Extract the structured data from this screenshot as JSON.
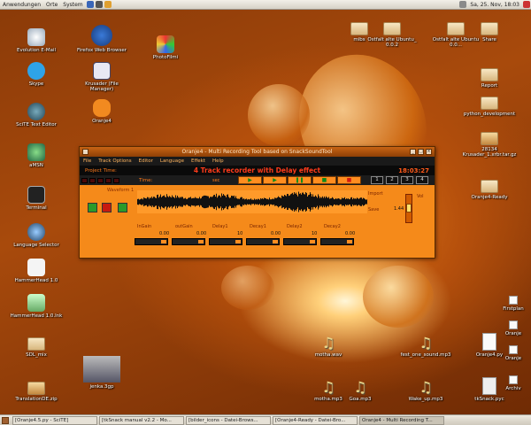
{
  "top_panel": {
    "menus": [
      "Anwendungen",
      "Orte",
      "System"
    ],
    "clock": "Sa, 25. Nov, 18:03"
  },
  "desktop_icons_left": [
    {
      "label": "Evolution E-Mail",
      "icon": "evolution-mail-icon"
    },
    {
      "label": "Skype",
      "icon": "skype-icon"
    },
    {
      "label": "SciTE Text Editor",
      "icon": "scite-editor-icon"
    },
    {
      "label": "aMSN",
      "icon": "amsn-icon"
    },
    {
      "label": "Terminal",
      "icon": "terminal-icon"
    },
    {
      "label": "Language Selector",
      "icon": "language-selector-icon"
    },
    {
      "label": "HammerHead 1.0",
      "icon": "hammer-icon"
    },
    {
      "label": "HammerHead 1.0.lnk",
      "icon": "hammer-link-icon"
    },
    {
      "label": "SDL_mix",
      "icon": "folder-icon"
    },
    {
      "label": "TranslationDE.zip",
      "icon": "archive-icon"
    }
  ],
  "desktop_icons_mid": [
    {
      "label": "Firefox Web Browser",
      "icon": "firefox-icon"
    },
    {
      "label": "Krusader (File Manager)",
      "icon": "krusader-icon"
    },
    {
      "label": "Oranje4",
      "icon": "oranje-icon"
    },
    {
      "label": "PhotoFilmi",
      "icon": "photofilm-icon"
    },
    {
      "label": "jenka.3gp",
      "icon": "video-icon"
    }
  ],
  "desktop_icons_right": [
    {
      "label": "mibs"
    },
    {
      "label": "Ostfalt alte Ubuntu_ 0.0.2"
    },
    {
      "label": "Ostfalt alte Ubuntu 0.0..."
    },
    {
      "label": "Share"
    },
    {
      "label": "Report"
    },
    {
      "label": "python_development"
    },
    {
      "label": "28134 Krusader_1.xrbr.tar.gz"
    },
    {
      "label": "Oranje4-Ready"
    }
  ],
  "desktop_files_bottom": [
    {
      "label": "motha.wav",
      "icon": "music-note-icon"
    },
    {
      "label": "fest_one_sound.mp3",
      "icon": "music-note-icon"
    },
    {
      "label": "Oranje4.py",
      "icon": "python-file-icon"
    },
    {
      "label": "motha.mp3",
      "icon": "music-note-icon"
    },
    {
      "label": "Goa.mp3",
      "icon": "music-note-icon"
    },
    {
      "label": "Wake_up.mp3",
      "icon": "music-note-icon"
    },
    {
      "label": "tkSnack.pyc",
      "icon": "pyc-file-icon"
    }
  ],
  "desktop_files_far_right": [
    "Firstplan",
    "Oranje",
    "Oranje",
    "Archiv"
  ],
  "app": {
    "title": "Oranje4 - Multi Recording Tool based on SnackSoundTool",
    "menus": [
      "File",
      "Track Options",
      "Editor",
      "Language",
      "Effekt",
      "Help"
    ],
    "project_label": "Project Time:",
    "main_title": "4 Track recorder with Delay effect",
    "clock": "18:03:27",
    "time_label": "Time:",
    "sec_label": "sec",
    "transport": [
      "▶",
      "▶",
      "❚❚",
      "■",
      "■"
    ],
    "tracks": [
      "1",
      "2",
      "3",
      "4"
    ],
    "waveform_label": "Waveform 1",
    "import_label": "Import",
    "save_label": "Save",
    "vol_label": "Vol",
    "vol_value": "1.44",
    "params": [
      {
        "label": "InGain",
        "value": "0.00"
      },
      {
        "label": "outGain",
        "value": "0.00"
      },
      {
        "label": "Delay1",
        "value": "10"
      },
      {
        "label": "Decay1",
        "value": "0.00"
      },
      {
        "label": "Delay2",
        "value": "10"
      },
      {
        "label": "Decay2",
        "value": "0.00"
      }
    ],
    "colors": {
      "accent": "#f58a1a",
      "title_red": "#ff3b1a",
      "play_green": "#0a8a1a"
    }
  },
  "taskbar": [
    "[Oranje4.5.py - SciTE]",
    "[tkSnack manual v2.2 - Mo...",
    "[bilder_icons - Datei-Brows...",
    "[Oranje4-Ready - Datei-Bro...",
    "Oranje4 - Multi Recording T..."
  ]
}
